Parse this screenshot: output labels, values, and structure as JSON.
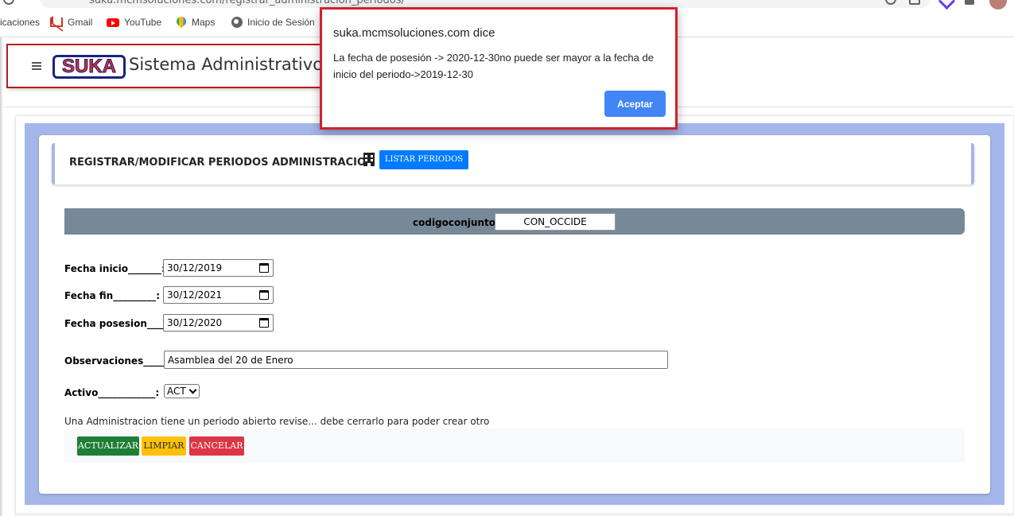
{
  "browser": {
    "url": "suka.mcmsoluciones.com/registrar_administracion_periodos/",
    "bookmarks": [
      {
        "label": "icaciones",
        "icon": "apps-icon"
      },
      {
        "label": "Gmail",
        "icon": "gmail-icon"
      },
      {
        "label": "YouTube",
        "icon": "youtube-icon"
      },
      {
        "label": "Maps",
        "icon": "maps-icon"
      },
      {
        "label": "Inicio de Sesión",
        "icon": "globe-icon"
      }
    ]
  },
  "app": {
    "logo_text": "SUKA",
    "title": "Sistema Administrativo"
  },
  "form": {
    "title": "REGISTRAR/MODIFICAR PERIODOS ADMINISTRACION",
    "listar_label": "LISTAR PERIODOS",
    "codigo_label": "codigoconjunto:",
    "codigo_value": "CON_OCCIDE",
    "fecha_inicio_label": "Fecha inicio_______:",
    "fecha_inicio_value": "30/12/2019",
    "fecha_fin_label": "Fecha fin_________:",
    "fecha_fin_value": "30/12/2021",
    "fecha_posesion_label": "Fecha posesion____:",
    "fecha_posesion_value": "30/12/2020",
    "observaciones_label": "Observaciones_____:",
    "observaciones_value": "Asamblea del 20 de Enero",
    "activo_label": "Activo____________:",
    "activo_value": "ACT",
    "message": "Una Administracion tiene un periodo abierto revise... debe cerrarlo para poder crear otro",
    "buttons": {
      "actualizar": "ACTUALIZAR",
      "limpiar": "LIMPIAR",
      "cancelar": "CANCELAR"
    }
  },
  "dialog": {
    "title": "suka.mcmsoluciones.com dice",
    "message": "La fecha  de posesión -> 2020-12-30no puede ser mayor a la fecha de inicio del periodo->2019-12-30",
    "accept_label": "Aceptar"
  },
  "colors": {
    "accent_blue": "#007bff",
    "form_background": "#a4b6ea",
    "bar_gray": "#778899",
    "success": "#1e7e34",
    "warning": "#ffc107",
    "danger": "#dc3545",
    "dialog_border": "#d0202e",
    "dialog_button": "#4285f4"
  }
}
